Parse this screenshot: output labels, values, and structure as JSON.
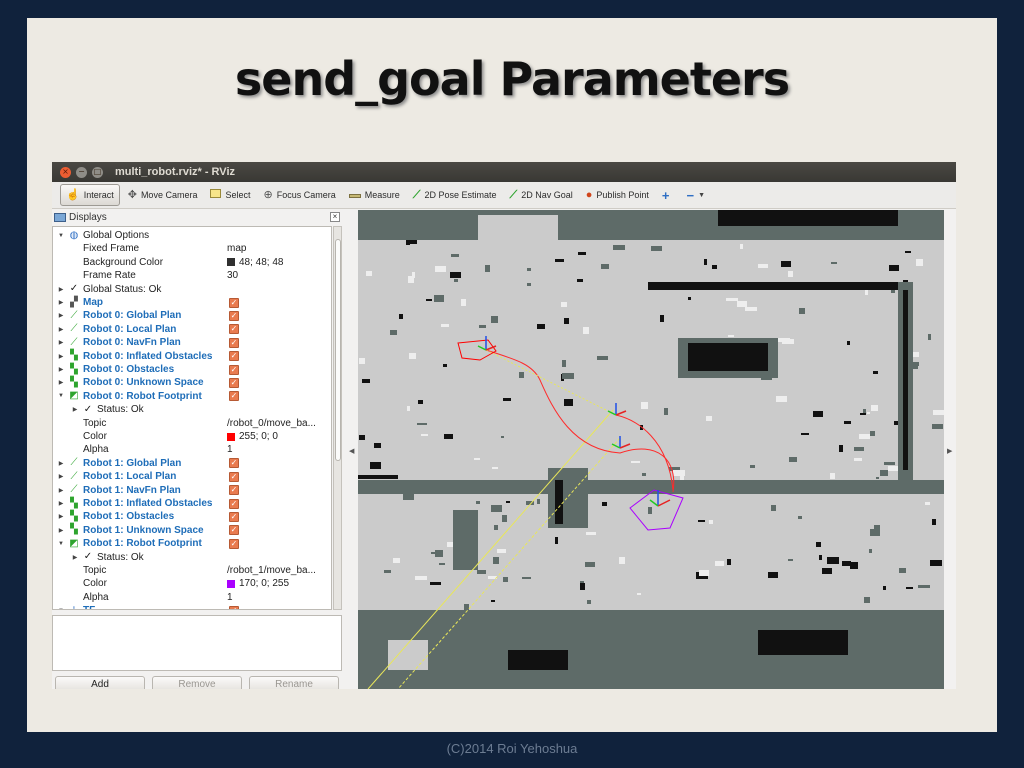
{
  "slide": {
    "title": "send_goal Parameters",
    "footer": "(C)2014 Roi Yehoshua"
  },
  "window": {
    "title": "multi_robot.rviz* - RViz",
    "controls": [
      "close",
      "minimize",
      "maximize"
    ]
  },
  "toolbar": {
    "tools": [
      {
        "id": "interact",
        "label": "Interact",
        "icon": "hand-icon",
        "active": true
      },
      {
        "id": "move_camera",
        "label": "Move Camera",
        "icon": "move-camera-icon"
      },
      {
        "id": "select",
        "label": "Select",
        "icon": "select-box-icon"
      },
      {
        "id": "focus_camera",
        "label": "Focus Camera",
        "icon": "focus-camera-icon"
      },
      {
        "id": "measure",
        "label": "Measure",
        "icon": "ruler-icon"
      },
      {
        "id": "pose_estimate",
        "label": "2D Pose Estimate",
        "icon": "pose-arrow-icon"
      },
      {
        "id": "nav_goal",
        "label": "2D Nav Goal",
        "icon": "nav-goal-arrow-icon"
      },
      {
        "id": "publish_point",
        "label": "Publish Point",
        "icon": "map-pin-icon"
      }
    ],
    "add_tool_icon": "plus-icon",
    "remove_tool_icon": "minus-icon",
    "accent_color": "#3a9a2a"
  },
  "displays_panel": {
    "title": "Displays",
    "rows": [
      {
        "indent": 0,
        "arrow": "down",
        "icon": "globe",
        "label": "Global Options",
        "style": "normal"
      },
      {
        "indent": 1,
        "arrow": "",
        "icon": "",
        "label": "Fixed Frame",
        "value": "map",
        "style": "normal"
      },
      {
        "indent": 1,
        "arrow": "",
        "icon": "",
        "label": "Background Color",
        "value": "48; 48; 48",
        "swatch": "#303030",
        "style": "normal"
      },
      {
        "indent": 1,
        "arrow": "",
        "icon": "",
        "label": "Frame Rate",
        "value": "30",
        "style": "normal"
      },
      {
        "indent": 0,
        "arrow": "right",
        "icon": "check",
        "label": "Global Status: Ok",
        "style": "normal"
      },
      {
        "indent": 0,
        "arrow": "right",
        "icon": "map",
        "label": "Map",
        "style": "blue",
        "checked": true
      },
      {
        "indent": 0,
        "arrow": "right",
        "icon": "path",
        "label": "Robot 0: Global Plan",
        "style": "blue",
        "checked": true
      },
      {
        "indent": 0,
        "arrow": "right",
        "icon": "path",
        "label": "Robot 0: Local Plan",
        "style": "blue",
        "checked": true
      },
      {
        "indent": 0,
        "arrow": "right",
        "icon": "path",
        "label": "Robot 0: NavFn Plan",
        "style": "blue",
        "checked": true
      },
      {
        "indent": 0,
        "arrow": "right",
        "icon": "grid",
        "label": "Robot 0: Inflated Obstacles",
        "style": "blue",
        "checked": true
      },
      {
        "indent": 0,
        "arrow": "right",
        "icon": "grid",
        "label": "Robot 0: Obstacles",
        "style": "blue",
        "checked": true
      },
      {
        "indent": 0,
        "arrow": "right",
        "icon": "grid",
        "label": "Robot 0: Unknown Space",
        "style": "blue",
        "checked": true
      },
      {
        "indent": 0,
        "arrow": "down",
        "icon": "polygon",
        "label": "Robot 0: Robot Footprint",
        "style": "blue",
        "checked": true
      },
      {
        "indent": 1,
        "arrow": "right",
        "icon": "check",
        "label": "Status: Ok",
        "style": "normal"
      },
      {
        "indent": 1,
        "arrow": "",
        "icon": "",
        "label": "Topic",
        "value": "/robot_0/move_ba...",
        "style": "normal"
      },
      {
        "indent": 1,
        "arrow": "",
        "icon": "",
        "label": "Color",
        "value": "255; 0; 0",
        "swatch": "#ff0000",
        "style": "normal"
      },
      {
        "indent": 1,
        "arrow": "",
        "icon": "",
        "label": "Alpha",
        "value": "1",
        "style": "normal"
      },
      {
        "indent": 0,
        "arrow": "right",
        "icon": "path",
        "label": "Robot 1: Global Plan",
        "style": "blue",
        "checked": true
      },
      {
        "indent": 0,
        "arrow": "right",
        "icon": "path",
        "label": "Robot 1: Local Plan",
        "style": "blue",
        "checked": true
      },
      {
        "indent": 0,
        "arrow": "right",
        "icon": "path",
        "label": "Robot 1: NavFn Plan",
        "style": "blue",
        "checked": true
      },
      {
        "indent": 0,
        "arrow": "right",
        "icon": "grid",
        "label": "Robot 1: Inflated Obstacles",
        "style": "blue",
        "checked": true
      },
      {
        "indent": 0,
        "arrow": "right",
        "icon": "grid",
        "label": "Robot 1: Obstacles",
        "style": "blue",
        "checked": true
      },
      {
        "indent": 0,
        "arrow": "right",
        "icon": "grid",
        "label": "Robot 1: Unknown Space",
        "style": "blue",
        "checked": true
      },
      {
        "indent": 0,
        "arrow": "down",
        "icon": "polygon",
        "label": "Robot 1: Robot Footprint",
        "style": "blue",
        "checked": true
      },
      {
        "indent": 1,
        "arrow": "right",
        "icon": "check",
        "label": "Status: Ok",
        "style": "normal"
      },
      {
        "indent": 1,
        "arrow": "",
        "icon": "",
        "label": "Topic",
        "value": "/robot_1/move_ba...",
        "style": "normal"
      },
      {
        "indent": 1,
        "arrow": "",
        "icon": "",
        "label": "Color",
        "value": "170; 0; 255",
        "swatch": "#aa00ff",
        "style": "normal"
      },
      {
        "indent": 1,
        "arrow": "",
        "icon": "",
        "label": "Alpha",
        "value": "1",
        "style": "normal"
      },
      {
        "indent": 0,
        "arrow": "down",
        "icon": "tf",
        "label": "TF",
        "style": "blue",
        "checked": true
      }
    ],
    "buttons": {
      "add": "Add",
      "remove": "Remove",
      "rename": "Rename"
    }
  },
  "viewport": {
    "background": "#cbcbcb",
    "obstacle_color": "#5e6b68",
    "wall_color": "#111111",
    "robot0_footprint_color": "#ff0000",
    "robot1_footprint_color": "#aa00ff",
    "plan_color": "#ff2a2a",
    "nav_line_color": "#e8e65a"
  }
}
